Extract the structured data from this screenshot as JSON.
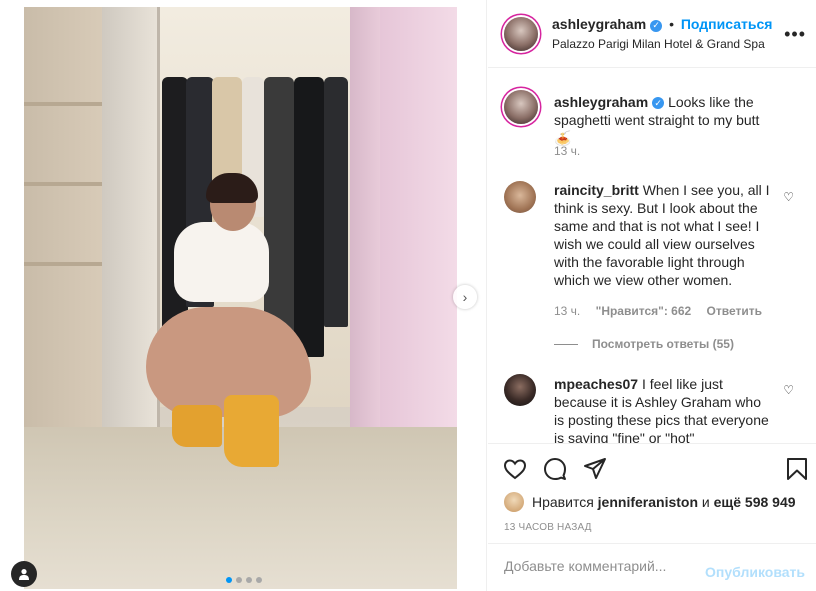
{
  "post": {
    "author": "ashleygraham",
    "follow_label": "Подписаться",
    "location": "Palazzo Parigi Milan Hotel & Grand Spa",
    "more_label": "•••",
    "caption": "Looks like the spaghetti went straight to my butt 🍝",
    "caption_time": "13 ч.",
    "media": {
      "slide_count": 4,
      "active_slide": 1
    }
  },
  "comments": [
    {
      "user": "raincity_britt",
      "text": "When I see you, all I think is sexy. But I look about the same and that is not what I see! I wish we could all view ourselves with the favorable light through which we view other women.",
      "time": "13 ч.",
      "likes_label": "\"Нравится\": 662",
      "reply_label": "Ответить",
      "view_replies": "Посмотреть ответы (55)"
    },
    {
      "user": "mpeaches07",
      "text": "I feel like just because it is Ashley Graham who is posting these pics that everyone is saying \"fine\" or \"hot\""
    }
  ],
  "actions": {
    "liked_prefix": "Нравится",
    "liked_user": "jenniferaniston",
    "liked_and": "и",
    "liked_count": "ещё 598 949",
    "timestamp": "13 ЧАСОВ НАЗАД"
  },
  "composer": {
    "placeholder": "Добавьте комментарий...",
    "publish_label": "Опубликовать"
  },
  "colors": {
    "accent": "#0095f6",
    "publish_disabled": "#b2dffc",
    "verified": "#3897f0"
  }
}
